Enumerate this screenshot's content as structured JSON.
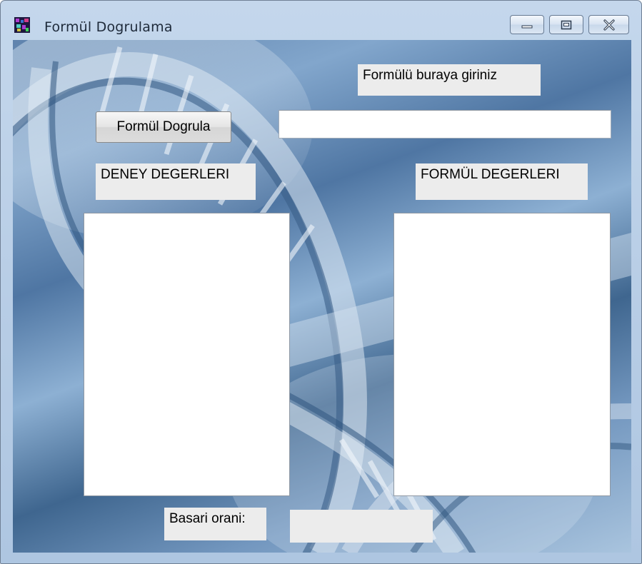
{
  "window": {
    "title": "Formül Dogrulama",
    "controls": {
      "minimize": "minimize-icon",
      "maximize": "maximize-icon",
      "close": "close-icon"
    }
  },
  "form": {
    "formula_prompt": "Formülü buraya giriniz",
    "formula_input_value": "",
    "verify_button_label": "Formül Dogrula",
    "experiment_values_label": "DENEY DEGERLERI",
    "formula_values_label": "FORMÜL DEGERLERI",
    "experiment_values_items": [],
    "formula_values_items": [],
    "success_rate_label": "Basari orani:",
    "success_rate_value": ""
  },
  "colors": {
    "label_background": "#ececec",
    "titlebar": "#c1d5ea",
    "background_accent": "#5b82ad"
  }
}
